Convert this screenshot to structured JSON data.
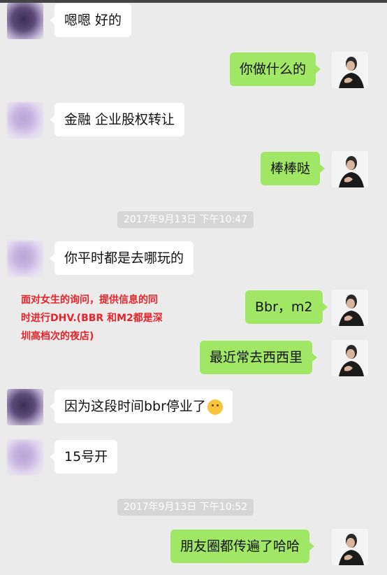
{
  "messages": [
    {
      "text": "嗯嗯 好的"
    },
    {
      "text": "你做什么的"
    },
    {
      "text": "金融 企业股权转让"
    },
    {
      "text": "棒棒哒"
    },
    {
      "text": "你平时都是去哪玩的"
    },
    {
      "text": "Bbr，m2"
    },
    {
      "text": "最近常去西西里"
    },
    {
      "text": "因为这段时间bbr停业了"
    },
    {
      "text": "15号开"
    },
    {
      "text": "朋友圈都传遍了哈哈"
    }
  ],
  "timestamps": [
    "2017年9月13日 下午10:47",
    "2017年9月13日 下午10:52"
  ],
  "annotation": {
    "lines": [
      "面对女生的询问，提供信息的同",
      "时进行DHV.(BBR 和M2都是深",
      "圳高档次的夜店)"
    ],
    "color": "#e8232a"
  },
  "colors": {
    "self_bubble": "#9fe765",
    "other_bubble": "#ffffff",
    "background": "#ebebeb"
  },
  "icons": {
    "emoji": "thinking-face-emoji",
    "avatar_other": "blurred-avatar",
    "avatar_self": "man-avatar"
  }
}
